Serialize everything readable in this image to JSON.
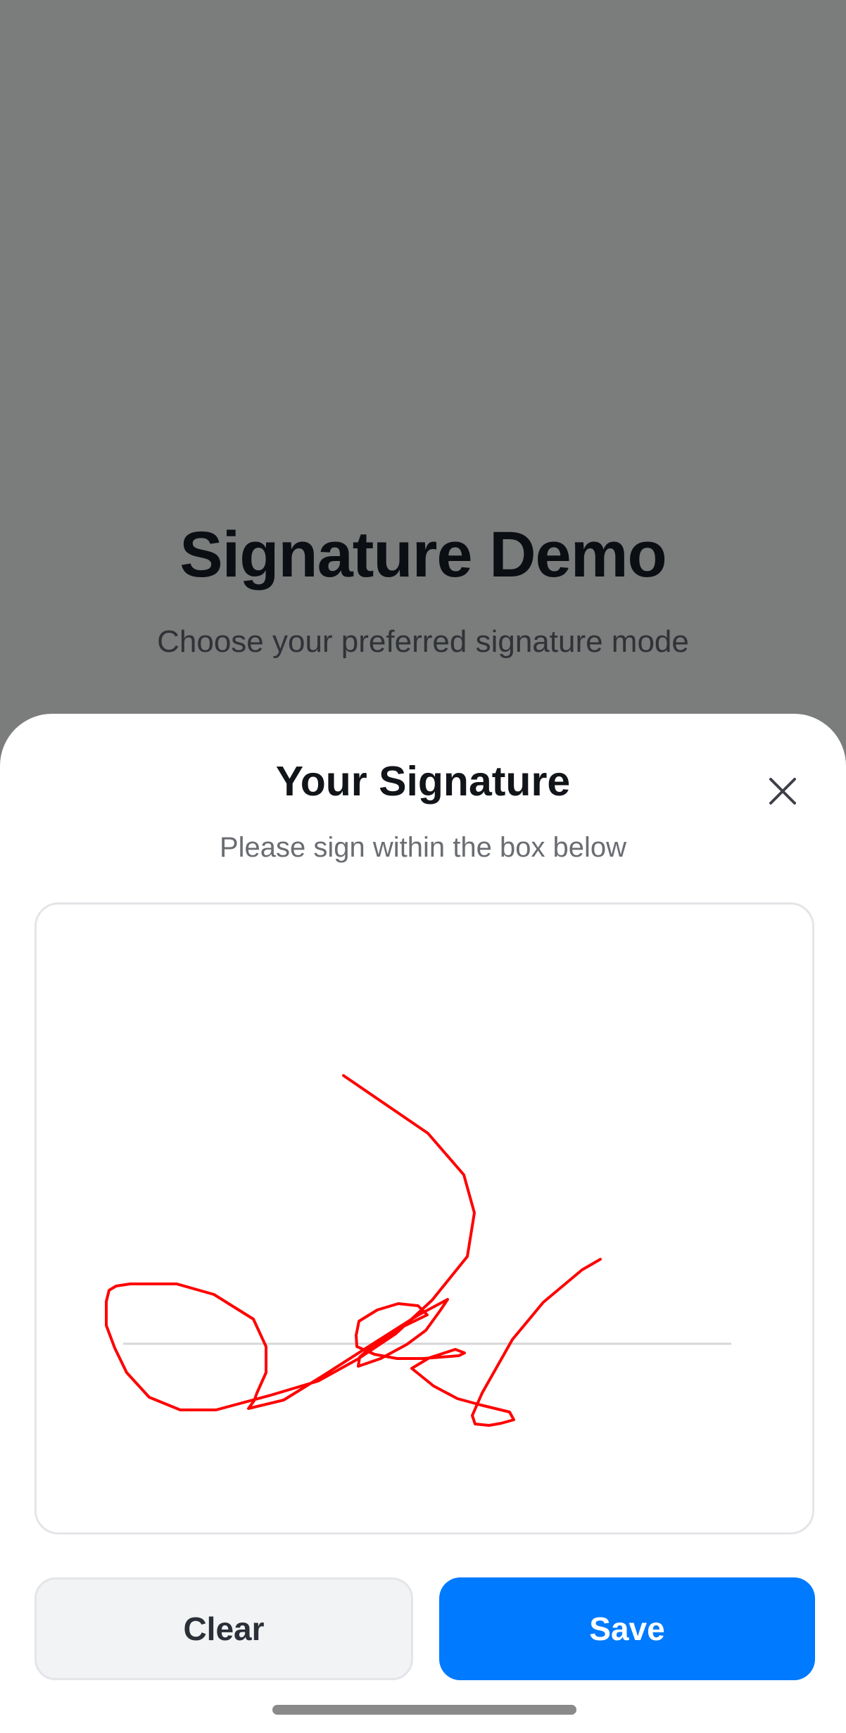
{
  "background": {
    "title": "Signature Demo",
    "subtitle": "Choose your preferred signature mode"
  },
  "sheet": {
    "title": "Your Signature",
    "subtitle": "Please sign within the box below",
    "close_icon": "close-icon"
  },
  "signature": {
    "stroke_color": "#ff0000",
    "baseline_color": "#d6d7d9"
  },
  "actions": {
    "clear_label": "Clear",
    "save_label": "Save"
  },
  "colors": {
    "overlay": "#7b7c7c",
    "accent": "#007aff",
    "secondary_button": "#f2f3f5"
  }
}
